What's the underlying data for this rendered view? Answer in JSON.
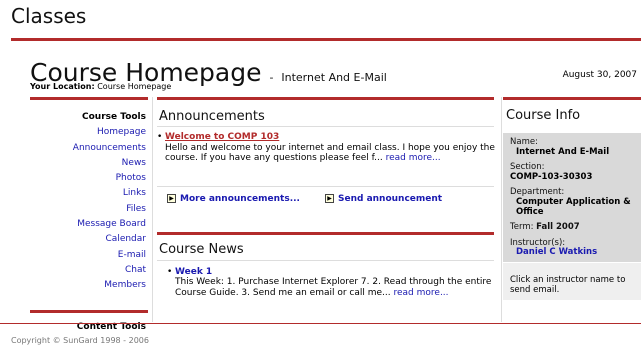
{
  "page": {
    "heading": "Classes"
  },
  "course": {
    "title": "Course Homepage",
    "title_separator": "-",
    "subtitle": "Internet And E-Mail",
    "location_label": "Your Location:",
    "location_value": "Course Homepage",
    "date": "August 30, 2007"
  },
  "nav": {
    "header": "Course Tools",
    "items": [
      {
        "label": "Homepage"
      },
      {
        "label": "Announcements"
      },
      {
        "label": "News"
      },
      {
        "label": "Photos"
      },
      {
        "label": "Links"
      },
      {
        "label": "Files"
      },
      {
        "label": "Message Board"
      },
      {
        "label": "Calendar"
      },
      {
        "label": "E-mail"
      },
      {
        "label": "Chat"
      },
      {
        "label": "Members"
      }
    ],
    "header2": "Content Tools"
  },
  "announcements": {
    "title": "Announcements",
    "item": {
      "title": "Welcome to COMP 103",
      "body": "Hello and welcome to your internet and email class. I hope you enjoy the course. If you have any questions please feel f...",
      "more": "read more..."
    },
    "more_link": "More announcements...",
    "send_link": "Send announcement"
  },
  "news": {
    "title": "Course News",
    "item": {
      "title": "Week 1",
      "body": "This Week: 1. Purchase Internet Explorer 7. 2. Read through the entire Course Guide. 3. Send me an email or call me...",
      "more": "read more..."
    }
  },
  "info": {
    "title": "Course Info",
    "name_label": "Name:",
    "name_value": "Internet And E-Mail",
    "section_label": "Section:",
    "section_value": "COMP-103-30303",
    "department_label": "Department:",
    "department_value": "Computer Application & Office",
    "term_label": "Term:",
    "term_value": "Fall 2007",
    "instructor_label": "Instructor(s):",
    "instructor_value": "Daniel C Watkins",
    "note": "Click an instructor name to send email."
  },
  "footer": {
    "copyright": "Copyright © SunGard 1998 - 2006"
  },
  "colors": {
    "accent_red": "#b22b2b",
    "link_blue": "#1a1ab0",
    "info_bg": "#d9d9d9"
  }
}
